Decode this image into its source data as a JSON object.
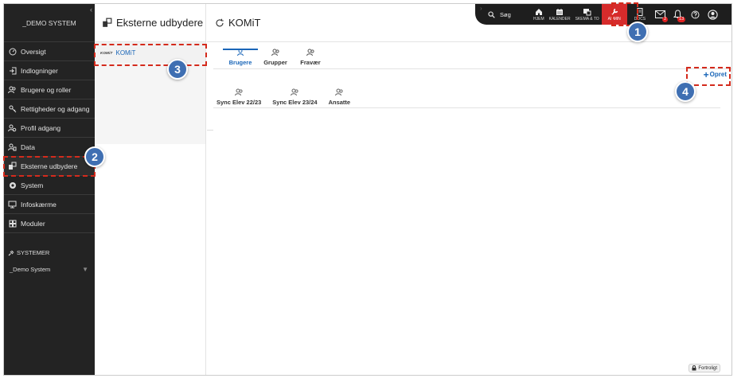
{
  "sidebar": {
    "system_name": "_DEMO SYSTEM",
    "items": [
      {
        "label": "Oversigt",
        "icon": "dashboard-icon"
      },
      {
        "label": "Indlogninger",
        "icon": "login-icon"
      },
      {
        "label": "Brugere og roller",
        "icon": "users-icon"
      },
      {
        "label": "Rettigheder og adgang",
        "icon": "key-icon"
      },
      {
        "label": "Profil adgang",
        "icon": "profile-users-icon"
      },
      {
        "label": "Data",
        "icon": "data-users-icon"
      },
      {
        "label": "Eksterne udbydere",
        "icon": "external-providers-icon"
      },
      {
        "label": "System",
        "icon": "gear-icon"
      },
      {
        "label": "Infoskærme",
        "icon": "monitor-icon"
      },
      {
        "label": "Moduler",
        "icon": "modules-icon"
      }
    ],
    "systems_title": "SYSTEMER",
    "systems_selected": "_Demo System"
  },
  "middle": {
    "title": "Eksterne udbydere",
    "items": [
      {
        "logo": "KOMiT",
        "label": "KOMiT"
      }
    ]
  },
  "main": {
    "title": "KOMiT",
    "tabs": [
      {
        "label": "Brugere"
      },
      {
        "label": "Grupper"
      },
      {
        "label": "Fravær"
      }
    ],
    "create_label": "Opret",
    "subtabs": [
      {
        "label": "Sync Elev 22/23"
      },
      {
        "label": "Sync Elev 23/24"
      },
      {
        "label": "Ansatte"
      }
    ]
  },
  "topbar": {
    "search_label": "Søg",
    "hjem": "HJEM",
    "kalender": "KALENDER",
    "skema": "SKEMA & TO",
    "admin": "ADMIN",
    "docs": "DOCS",
    "mail_badge": "2",
    "notif_badge": "13"
  },
  "footer": {
    "confidential": "Fortroligt"
  },
  "annotations": [
    "1",
    "2",
    "3",
    "4"
  ],
  "colors": {
    "accent": "#1a66b8",
    "admin": "#d62b2b",
    "highlight": "#d42a1c",
    "marker": "#3f6fb2"
  }
}
